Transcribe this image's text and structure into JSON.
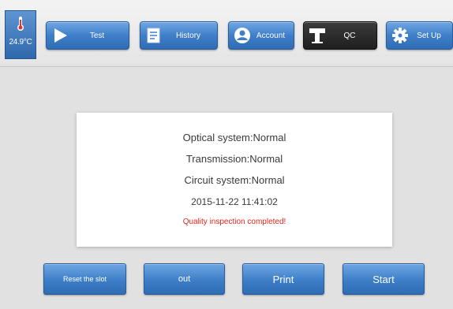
{
  "header": {
    "temperature": "24.9°C",
    "temperature_icon": "thermometer-icon",
    "nav": [
      {
        "label": "Test",
        "icon": "play-icon"
      },
      {
        "label": "History",
        "icon": "document-icon"
      },
      {
        "label": "Account",
        "icon": "account-icon"
      },
      {
        "label": "QC",
        "icon": "qc-icon",
        "active": true
      },
      {
        "label": "Set Up",
        "icon": "gear-icon"
      }
    ]
  },
  "status": {
    "optical": "Optical system:Normal",
    "transmission": "Transmission:Normal",
    "circuit": "Circuit system:Normal",
    "timestamp": "2015-11-22 11:41:02",
    "message": "Quality inspection completed!"
  },
  "actions": {
    "reset_slot": "Reset the slot",
    "out": "out",
    "print": "Print",
    "start": "Start"
  },
  "colors": {
    "accent": "#3f7fc9",
    "active_tab": "#1f1f1f",
    "error_text": "#e0261d"
  }
}
